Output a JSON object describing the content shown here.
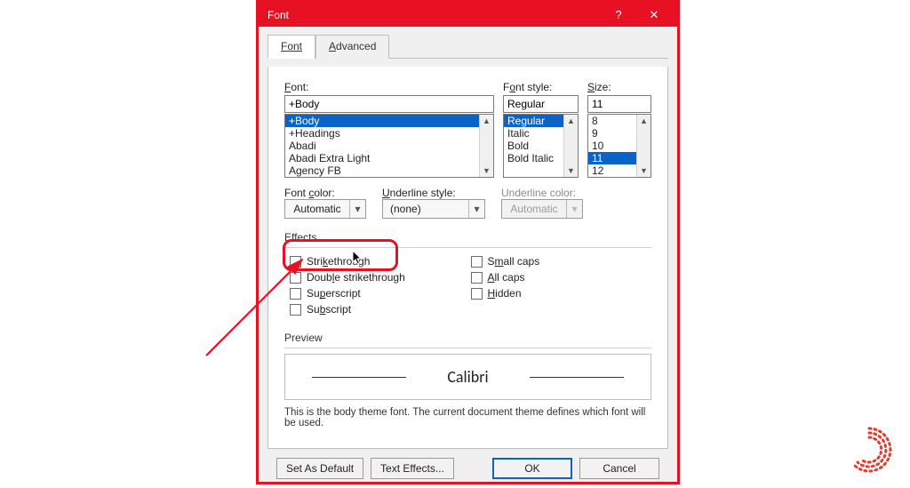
{
  "window": {
    "title": "Font"
  },
  "tabs": {
    "font": "Font",
    "advanced": "Advanced"
  },
  "labels": {
    "font": "Font:",
    "style": "Font style:",
    "size": "Size:",
    "font_color": "Font color:",
    "underline_style": "Underline style:",
    "underline_color": "Underline color:",
    "effects": "Effects",
    "preview": "Preview"
  },
  "font": {
    "value": "+Body",
    "list": [
      "+Body",
      "+Headings",
      "Abadi",
      "Abadi Extra Light",
      "Agency FB"
    ],
    "selected_index": 0
  },
  "style": {
    "value": "Regular",
    "list": [
      "Regular",
      "Italic",
      "Bold",
      "Bold Italic"
    ],
    "selected_index": 0
  },
  "size": {
    "value": "11",
    "list": [
      "8",
      "9",
      "10",
      "11",
      "12"
    ],
    "selected_index": 3
  },
  "color": {
    "font": "Automatic",
    "underline_style": "(none)",
    "underline_color": "Automatic"
  },
  "effects": {
    "strikethrough": "Strikethrough",
    "double_strikethrough": "Double strikethrough",
    "superscript": "Superscript",
    "subscript": "Subscript",
    "small_caps": "Small caps",
    "all_caps": "All caps",
    "hidden": "Hidden"
  },
  "preview": {
    "sample": "Calibri",
    "note": "This is the body theme font. The current document theme defines which font will be used."
  },
  "buttons": {
    "set_default": "Set As Default",
    "text_effects": "Text Effects...",
    "ok": "OK",
    "cancel": "Cancel"
  }
}
